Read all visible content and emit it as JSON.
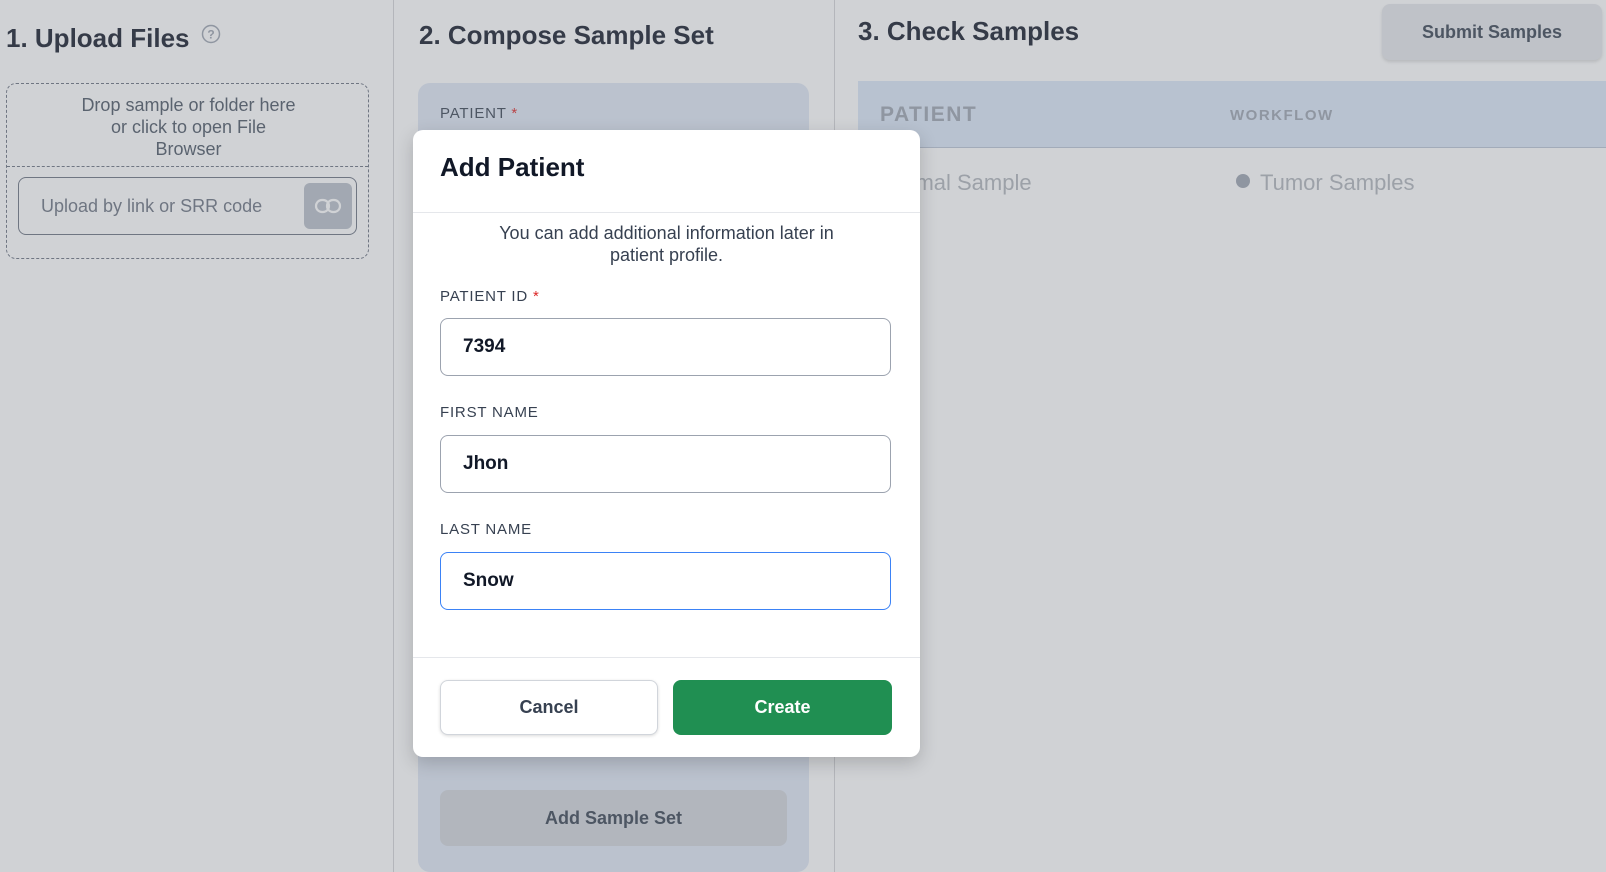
{
  "upload": {
    "title": "1. Upload Files",
    "help_icon": "question-circle-icon",
    "drop_text": "Drop sample or folder here or click to open File Browser",
    "link_placeholder": "Upload by link or SRR code",
    "link_icon": "link-icon"
  },
  "compose": {
    "title": "2. Compose Sample Set",
    "patient_label": "PATIENT",
    "required_mark": "*",
    "add_sample_set": "Add Sample Set"
  },
  "check": {
    "title": "3. Check Samples",
    "submit": "Submit Samples",
    "col_patient": "PATIENT",
    "col_workflow": "WORKFLOW",
    "legend_normal": "Normal Sample",
    "legend_tumor": "Tumor Samples"
  },
  "modal": {
    "title": "Add Patient",
    "description": "You can add additional information later in patient profile.",
    "required_mark": "*",
    "fields": {
      "patient_id": {
        "label": "PATIENT ID",
        "value": "7394"
      },
      "first_name": {
        "label": "FIRST NAME",
        "value": "Jhon"
      },
      "last_name": {
        "label": "LAST NAME",
        "value": "Snow"
      }
    },
    "cancel": "Cancel",
    "create": "Create"
  },
  "colors": {
    "primary_green": "#208f52",
    "focus_blue": "#3b82f6",
    "required_red": "#dc2626"
  }
}
